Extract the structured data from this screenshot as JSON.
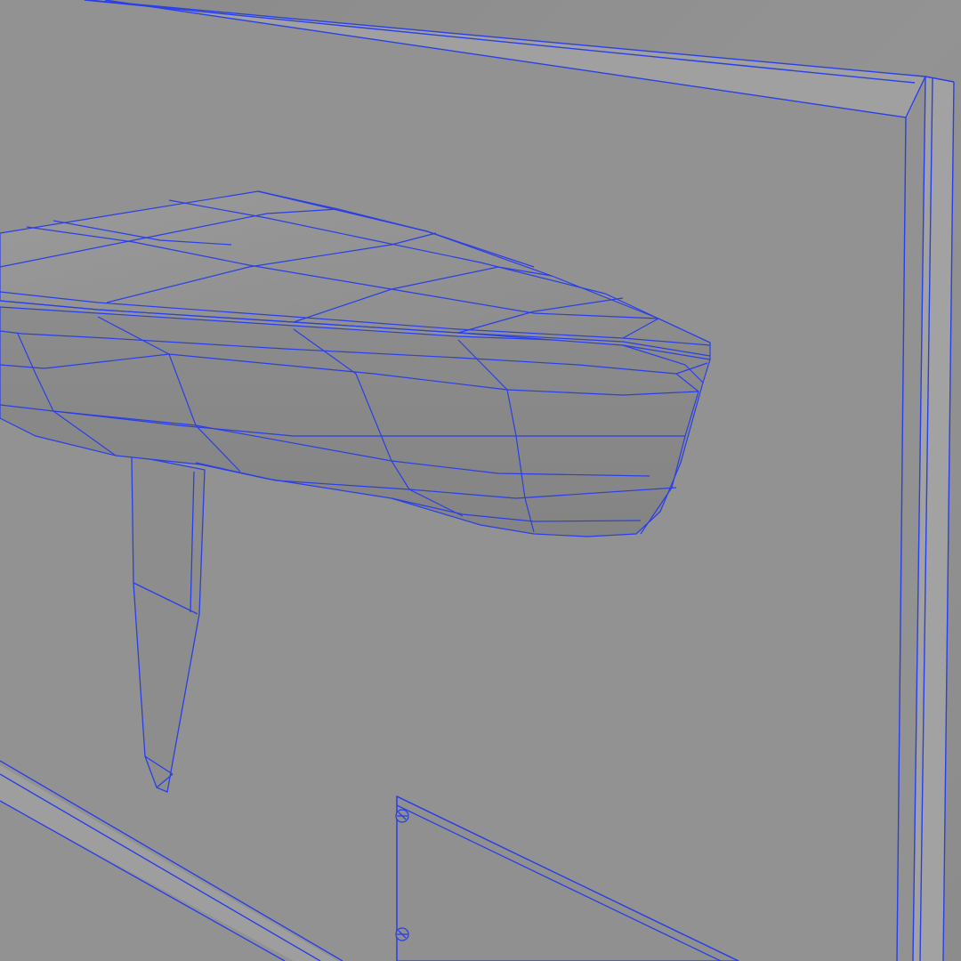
{
  "scene": {
    "kind": "3d-wireframe-render",
    "description_visible_text": "",
    "colors": {
      "background_wall": "#8f8f8f",
      "panel_face": "#939393",
      "frame_edge": "#a3a3a3",
      "hull_top": "#979797",
      "hull_side": "#8a8a8a",
      "keel": "#8d8d8d",
      "wire": "#2a3fe6"
    }
  }
}
